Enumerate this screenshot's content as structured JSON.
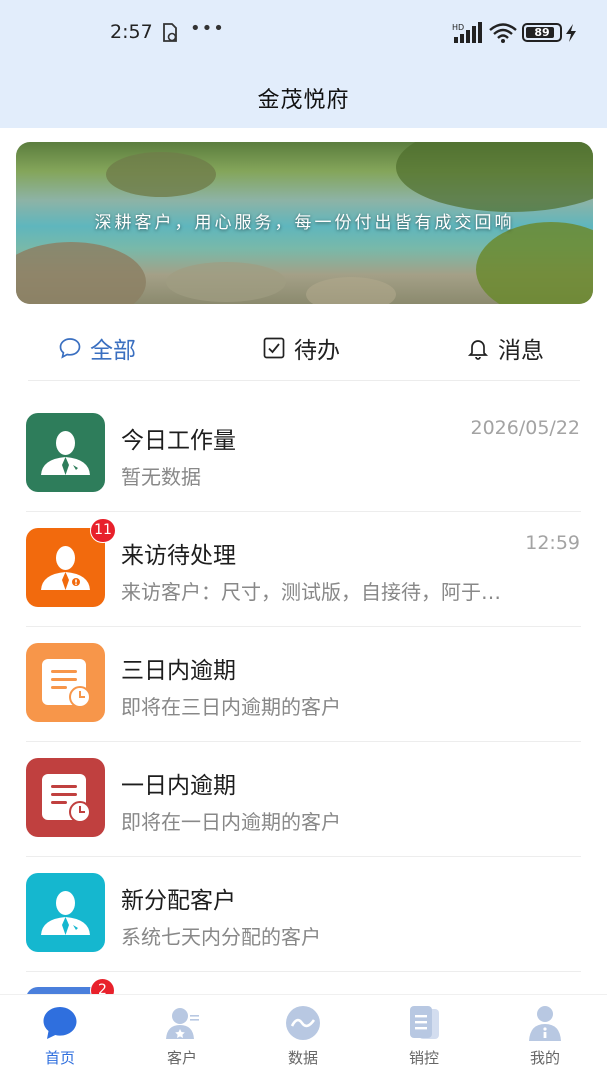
{
  "status_bar": {
    "time": "2:57",
    "dots": "•••",
    "battery_level": 89,
    "battery_text": "89",
    "network_label": "HD"
  },
  "header": {
    "title": "金茂悦府"
  },
  "banner": {
    "slogan": "深耕客户，用心服务，每一份付出皆有成交回响"
  },
  "tabs": [
    {
      "label": "全部",
      "icon": "chat-bubble-icon",
      "active": true
    },
    {
      "label": "待办",
      "icon": "checkbox-icon",
      "active": false
    },
    {
      "label": "消息",
      "icon": "bell-icon",
      "active": false
    }
  ],
  "list": [
    {
      "title": "今日工作量",
      "subtitle": "暂无数据",
      "time": "2026/05/22",
      "icon": "person-pin-icon",
      "color": "#2e7d5b",
      "badge": ""
    },
    {
      "title": "来访待处理",
      "subtitle": "来访客户：尺寸，测试版，自接待，阿于…",
      "time": "12:59",
      "icon": "person-alert-icon",
      "color": "#f26a0d",
      "badge": "11"
    },
    {
      "title": "三日内逾期",
      "subtitle": "即将在三日内逾期的客户",
      "time": "",
      "icon": "document-clock-icon",
      "color": "#f7964a",
      "badge": ""
    },
    {
      "title": "一日内逾期",
      "subtitle": "即将在一日内逾期的客户",
      "time": "",
      "icon": "document-clock-icon",
      "color": "#c0403f",
      "badge": ""
    },
    {
      "title": "新分配客户",
      "subtitle": "系统七天内分配的客户",
      "time": "",
      "icon": "person-pin-icon",
      "color": "#15b7cf",
      "badge": ""
    }
  ],
  "peek_item": {
    "badge": "2",
    "color": "#4a7fdc"
  },
  "nav": [
    {
      "label": "首页",
      "icon": "chat-home-icon",
      "active": true
    },
    {
      "label": "客户",
      "icon": "customer-icon",
      "active": false
    },
    {
      "label": "数据",
      "icon": "chart-wave-icon",
      "active": false
    },
    {
      "label": "销控",
      "icon": "document-stack-icon",
      "active": false
    },
    {
      "label": "我的",
      "icon": "profile-icon",
      "active": false
    }
  ],
  "colors": {
    "accent": "#2f6fde",
    "tab_active": "#3a6fc0",
    "header_bg": "#e2edfb",
    "badge": "#e8212b"
  }
}
